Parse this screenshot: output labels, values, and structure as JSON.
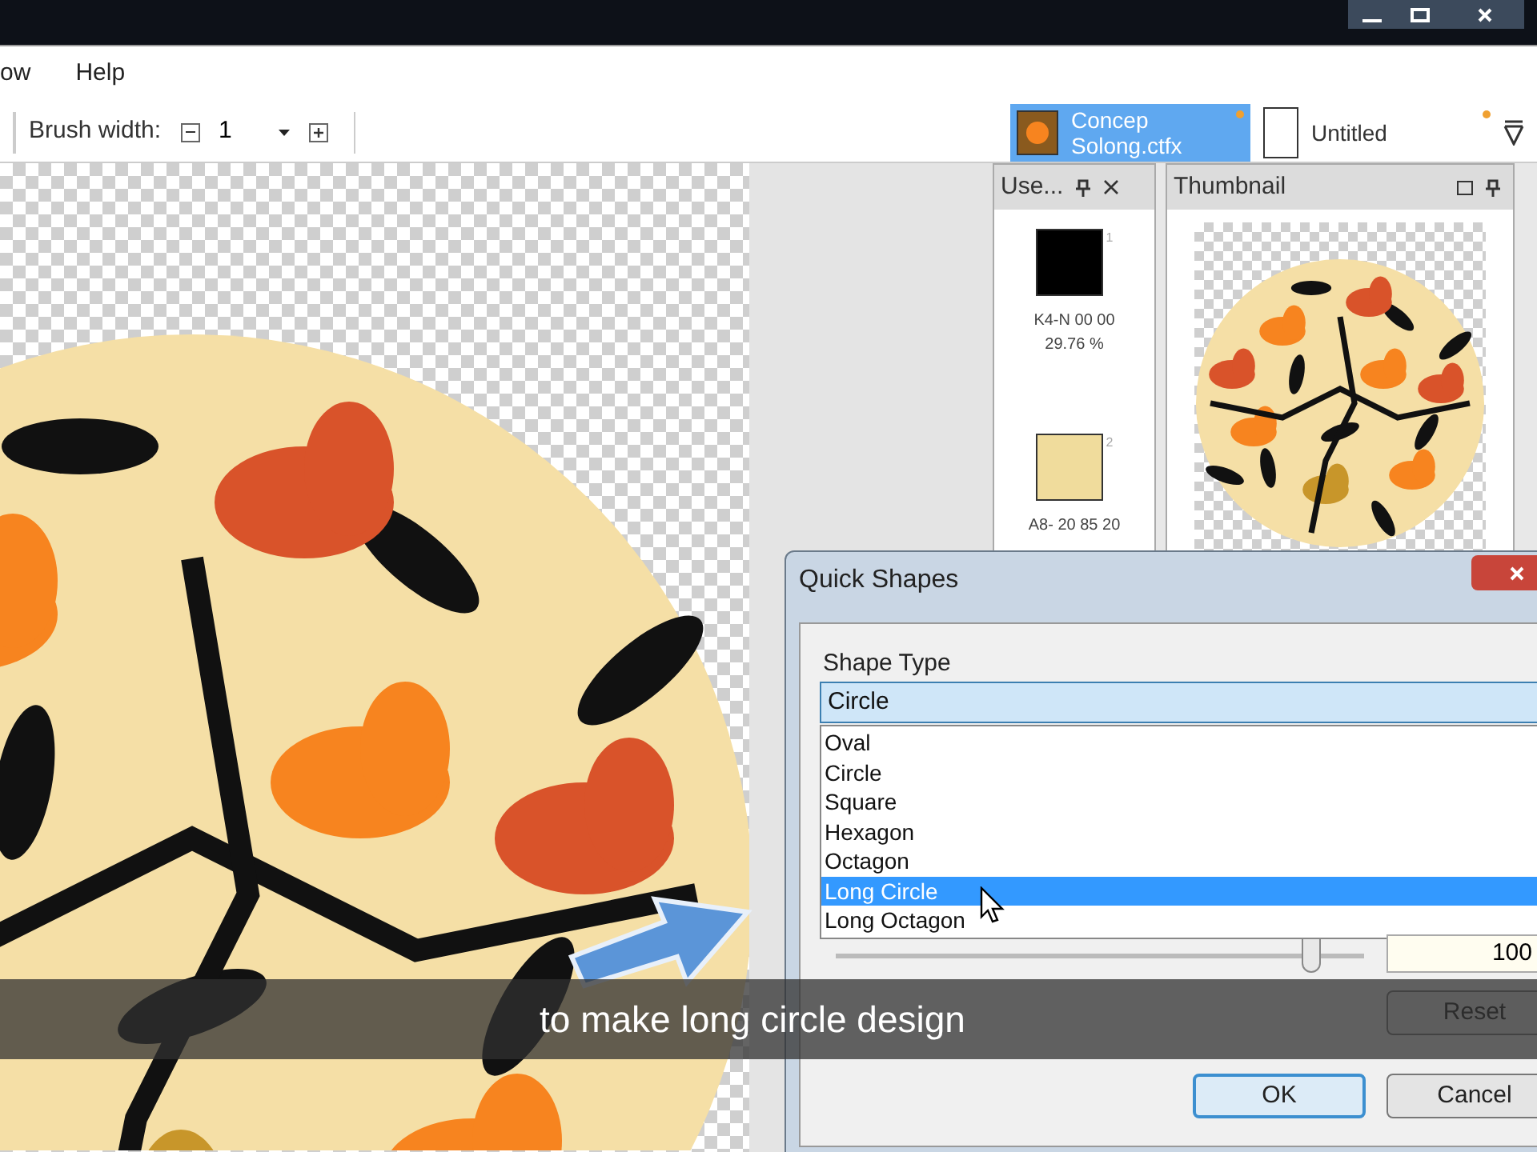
{
  "menu": [
    {
      "label": "ow"
    },
    {
      "label": "Help"
    }
  ],
  "toolbar": {
    "brush_width_label": "Brush width:",
    "brush_width_value": "1"
  },
  "document_tabs": [
    {
      "lines": [
        "Concep",
        "Solong.ctfx"
      ],
      "selected": true,
      "modified": true,
      "kind": "image"
    },
    {
      "lines": [
        "Untitled"
      ],
      "selected": false,
      "modified": true,
      "kind": "blank"
    }
  ],
  "colors_panel": {
    "title": "Use...",
    "swatches": [
      {
        "index": "1",
        "color": "#000000",
        "name": "K4-N 00 00",
        "share": "29.76 %"
      },
      {
        "index": "2",
        "color": "#f0dc9c",
        "name": "A8- 20 85 20"
      }
    ]
  },
  "thumbnail_panel": {
    "title": "Thumbnail"
  },
  "dialog": {
    "title": "Quick Shapes",
    "shape_type_label": "Shape Type",
    "shape_type_value": "Circle",
    "options": [
      {
        "label": "Oval",
        "selected": false
      },
      {
        "label": "Circle",
        "selected": false
      },
      {
        "label": "Square",
        "selected": false
      },
      {
        "label": "Hexagon",
        "selected": false
      },
      {
        "label": "Octagon",
        "selected": false
      },
      {
        "label": "Long Circle",
        "selected": true
      },
      {
        "label": "Long Octagon",
        "selected": false
      }
    ],
    "slider": {
      "level": 0.9
    },
    "value": "100",
    "buttons": [
      {
        "label": "Reset",
        "default": false
      },
      {
        "label": "OK",
        "default": true
      },
      {
        "label": "Cancel",
        "default": false
      }
    ]
  },
  "subtitle": "to make long circle design"
}
